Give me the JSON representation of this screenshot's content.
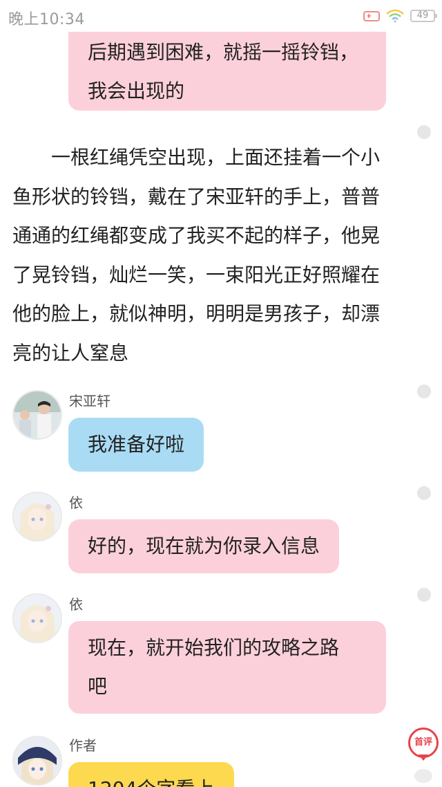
{
  "status_bar": {
    "time": "晚上10:34",
    "battery": "49"
  },
  "messages": [
    {
      "type": "bubble",
      "color": "#fcd0da",
      "lines": [
        "后期遇到困难，就摇一摇铃铛，",
        "我会出现的"
      ]
    },
    {
      "type": "narration",
      "lines": [
        "一根红绳凭空出现，上面还挂着一个小",
        "鱼形状的铃铛，戴在了宋亚轩的手上，普普",
        "通通的红绳都变成了我买不起的样子，他晃",
        "了晃铃铛，灿烂一笑，一束阳光正好照耀在",
        "他的脸上，就似神明，明明是男孩子，却漂",
        "亮的让人窒息"
      ]
    },
    {
      "type": "chat",
      "speaker": "宋亚轩",
      "color": "#a9dcf4",
      "lines": [
        "我准备好啦"
      ]
    },
    {
      "type": "chat",
      "speaker": "依",
      "color": "#fcd0da",
      "lines": [
        "好的，现在就为你录入信息"
      ]
    },
    {
      "type": "chat",
      "speaker": "依",
      "color": "#fcd0da",
      "lines": [
        "现在，就开始我们的攻略之路",
        "吧"
      ]
    },
    {
      "type": "chat",
      "speaker": "作者",
      "color": "#fcd94f",
      "lines": [
        "1204个字看上"
      ]
    }
  ],
  "floating_button": {
    "label": "首评",
    "icon": "comment-bubble-icon"
  }
}
